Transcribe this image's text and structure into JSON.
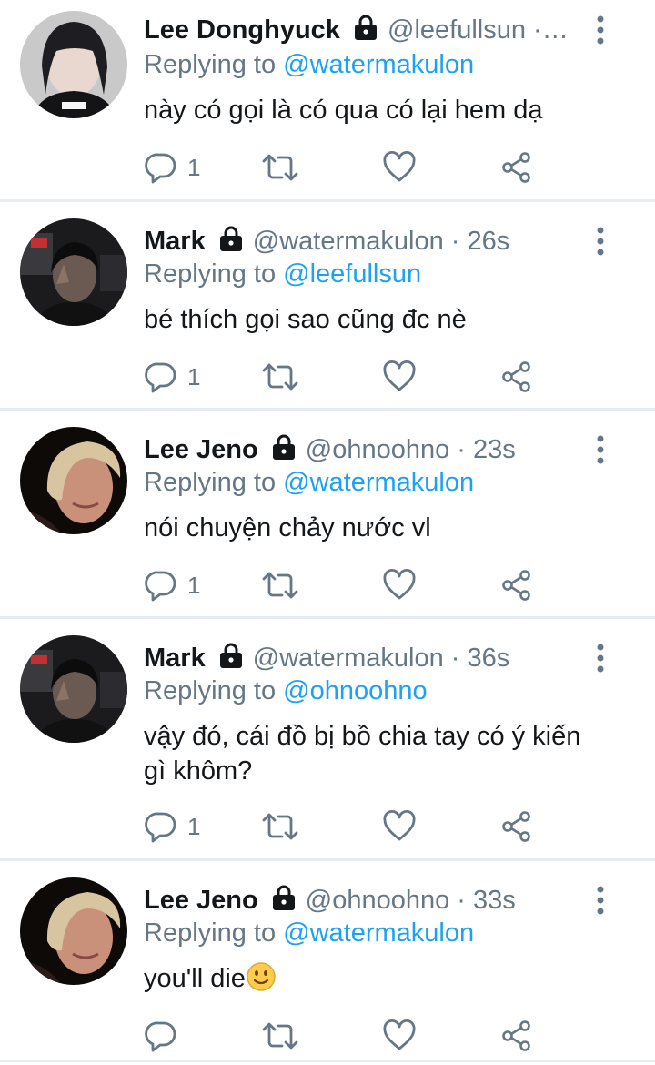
{
  "tweets": [
    {
      "name": "Lee Donghyuck",
      "handle": "@leefullsun",
      "sep": " ·",
      "time": "…",
      "replying_prefix": "Replying to ",
      "replying_to": "@watermakulon",
      "text": "này có gọi là có qua có lại hem dạ",
      "reply_count": "1"
    },
    {
      "name": "Mark",
      "handle": "@watermakulon",
      "sep": " · ",
      "time": "26s",
      "replying_prefix": "Replying to ",
      "replying_to": "@leefullsun",
      "text": "bé thích gọi sao cũng đc nè",
      "reply_count": "1"
    },
    {
      "name": "Lee Jeno",
      "handle": "@ohnoohno",
      "sep": " · ",
      "time": "23s",
      "replying_prefix": "Replying to ",
      "replying_to": "@watermakulon",
      "text": "nói chuyện chảy nước vl",
      "reply_count": "1"
    },
    {
      "name": "Mark",
      "handle": "@watermakulon",
      "sep": " · ",
      "time": "36s",
      "replying_prefix": "Replying to ",
      "replying_to": "@ohnoohno",
      "text": "vậy đó, cái đồ bị bồ chia tay có ý kiến gì khôm?",
      "reply_count": "1"
    },
    {
      "name": "Lee Jeno",
      "handle": "@ohnoohno",
      "sep": " · ",
      "time": "33s",
      "replying_prefix": "Replying to ",
      "replying_to": "@watermakulon",
      "text": "you'll die",
      "text_emoji": "slightly-smiling-face-icon",
      "reply_count": ""
    }
  ],
  "icons": {
    "lock": "lock-icon",
    "more": "more-vertical-icon",
    "reply": "reply-icon",
    "retweet": "retweet-icon",
    "like": "heart-icon",
    "share": "share-icon"
  },
  "colors": {
    "accent": "#1da1f2",
    "secondary_text": "#657786",
    "primary_text": "#14171a",
    "divider": "#e6ecf0"
  }
}
